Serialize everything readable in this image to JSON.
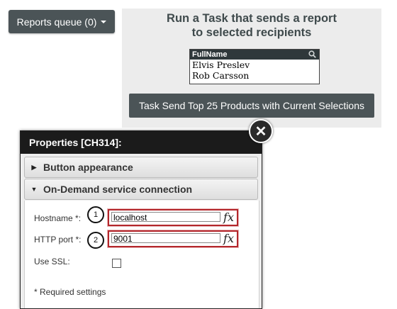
{
  "reports_queue": {
    "label": "Reports queue (0)"
  },
  "task_panel": {
    "heading_line1": "Run a Task that sends a report",
    "heading_line2": "to selected recipients",
    "listbox": {
      "column_header": "FullName",
      "rows": [
        "Elvis Preslev",
        "Rob Carsson"
      ]
    },
    "task_button_label": "Task Send Top 25 Products with Current Selections"
  },
  "dialog": {
    "title": "Properties [CH314]:",
    "close_symbol": "✕",
    "sections": {
      "button_appearance": {
        "label": "Button appearance",
        "arrow": "▶"
      },
      "ondemand": {
        "label": "On-Demand service connection",
        "arrow": "▼"
      }
    },
    "fields": {
      "hostname": {
        "label": "Hostname *:",
        "value": "localhost",
        "marker": "1",
        "fx": "fx"
      },
      "http_port": {
        "label": "HTTP port *:",
        "value": "9001",
        "marker": "2",
        "fx": "fx"
      },
      "use_ssl": {
        "label": "Use SSL:",
        "checked": false
      }
    },
    "required_note": "* Required settings"
  },
  "colors": {
    "dark_button": "#4b5457",
    "panel_bg": "#ececec",
    "dialog_title_bg": "#1b1b1b",
    "highlight_border": "#b3262b"
  }
}
